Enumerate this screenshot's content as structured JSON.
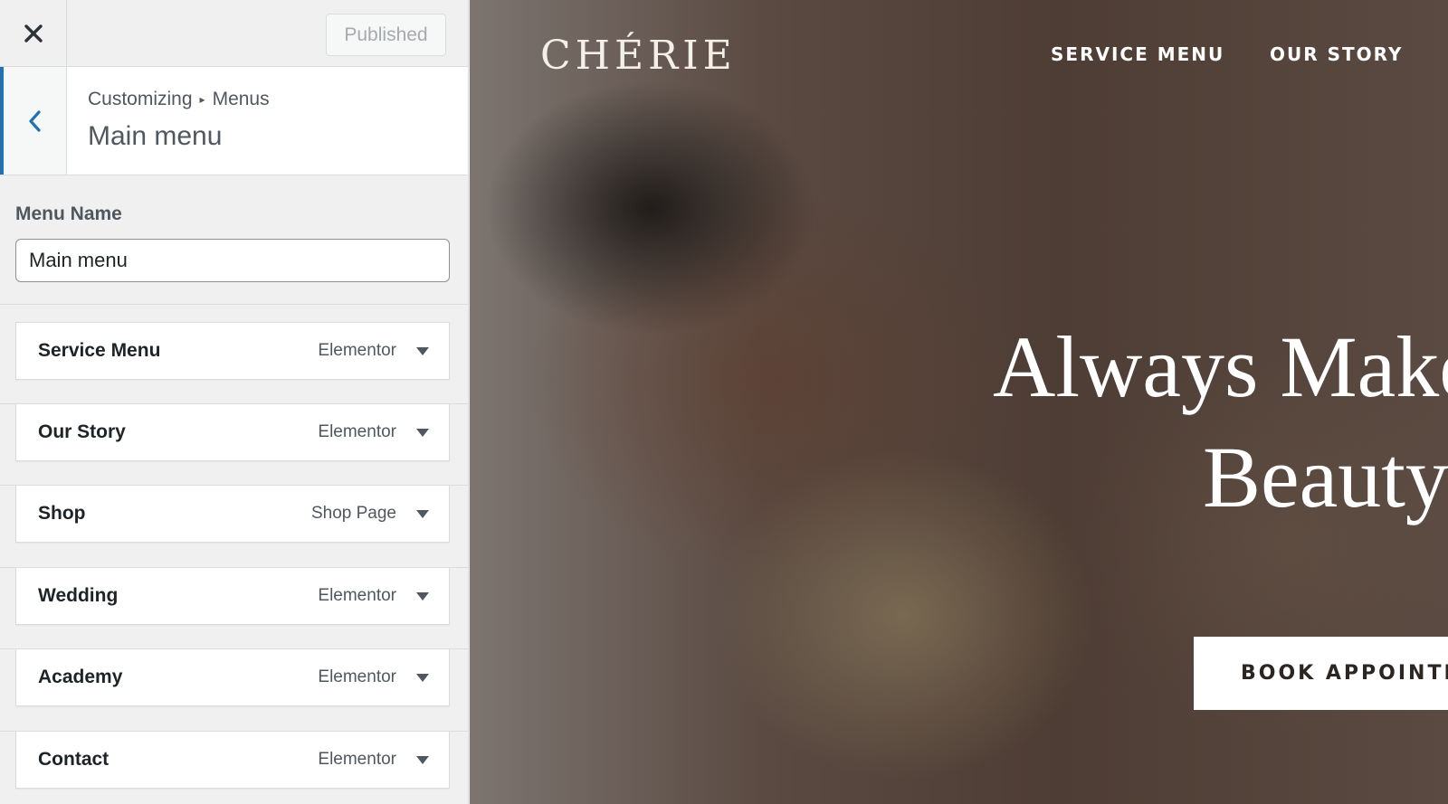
{
  "topbar": {
    "close_icon": "close-icon",
    "publish_label": "Published"
  },
  "section": {
    "breadcrumb_parent": "Customizing",
    "breadcrumb_separator": "▸",
    "breadcrumb_current": "Menus",
    "title": "Main menu",
    "back_icon": "chevron-left-icon",
    "accent_color": "#2271b1"
  },
  "menu_name": {
    "label": "Menu Name",
    "value": "Main menu"
  },
  "menu_items": [
    {
      "title": "Service Menu",
      "type": "Elementor"
    },
    {
      "title": "Our Story",
      "type": "Elementor"
    },
    {
      "title": "Shop",
      "type": "Shop Page"
    },
    {
      "title": "Wedding",
      "type": "Elementor"
    },
    {
      "title": "Academy",
      "type": "Elementor"
    },
    {
      "title": "Contact",
      "type": "Elementor"
    }
  ],
  "preview": {
    "logo": "CHÉRIE",
    "nav": [
      "SERVICE MENU",
      "OUR STORY"
    ],
    "hero_line_1": "Always Make",
    "hero_line_2": "Beauty",
    "cta": "BOOK APPOINTME"
  }
}
